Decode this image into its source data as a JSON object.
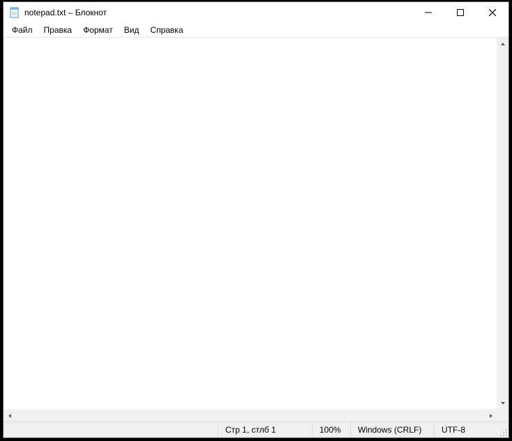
{
  "window": {
    "title": "notepad.txt – Блокнот"
  },
  "menu": {
    "file": "Файл",
    "edit": "Правка",
    "format": "Формат",
    "view": "Вид",
    "help": "Справка"
  },
  "editor": {
    "content": ""
  },
  "statusbar": {
    "position": "Стр 1, стлб 1",
    "zoom": "100%",
    "eol": "Windows (CRLF)",
    "encoding": "UTF-8"
  }
}
